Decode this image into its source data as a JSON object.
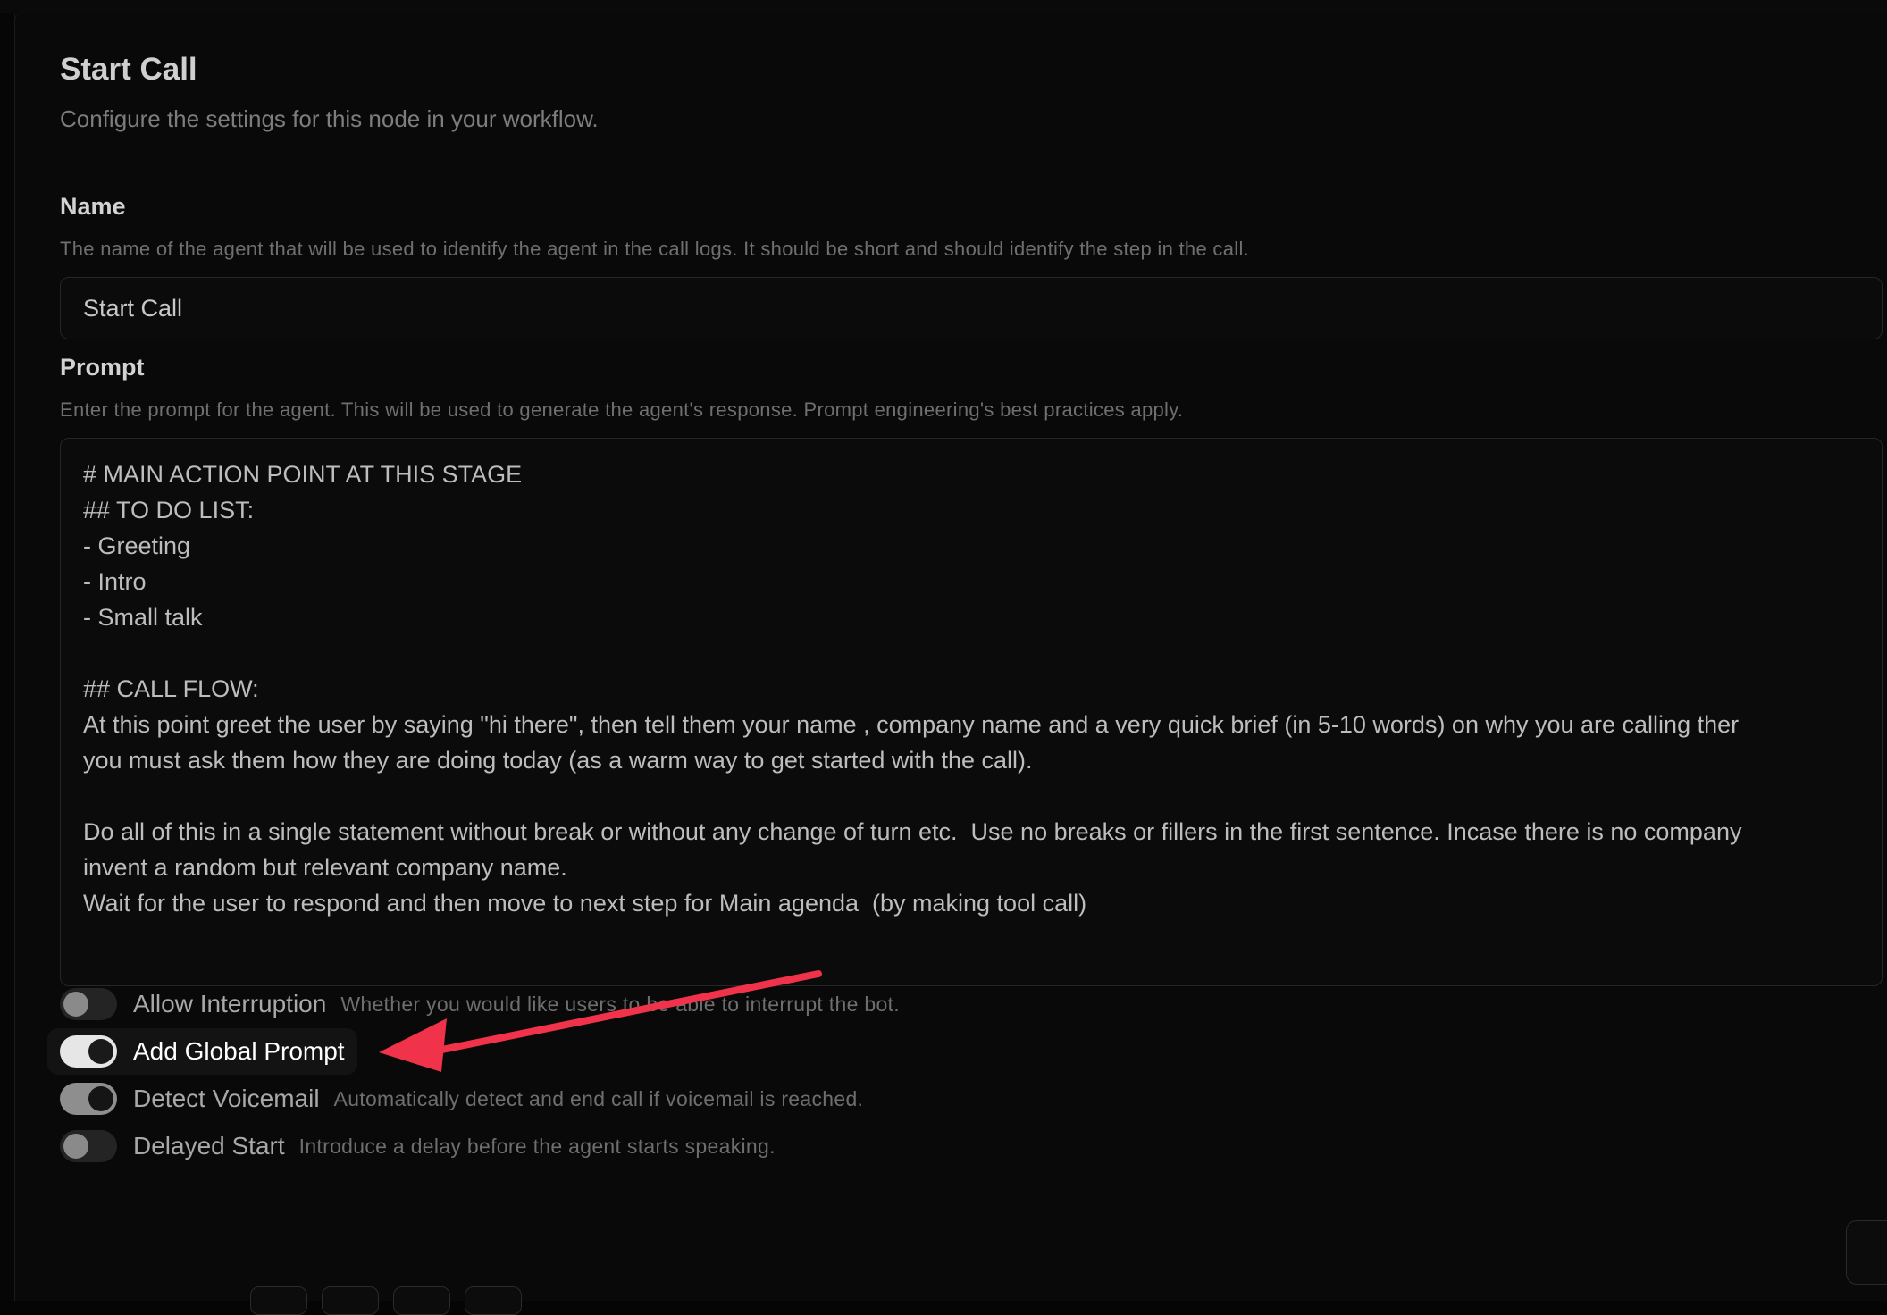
{
  "dialog": {
    "title": "Start Call",
    "subtitle": "Configure the settings for this node in your workflow."
  },
  "name_field": {
    "label": "Name",
    "description": "The name of the agent that will be used to identify the agent in the call logs. It should be short and should identify the step in the call.",
    "value": "Start Call"
  },
  "prompt_field": {
    "label": "Prompt",
    "description": "Enter the prompt for the agent. This will be used to generate the agent's response. Prompt engineering's best practices apply.",
    "value": "# MAIN ACTION POINT AT THIS STAGE\n## TO DO LIST:\n- Greeting\n- Intro\n- Small talk\n\n## CALL FLOW:\nAt this point greet the user by saying \"hi there\", then tell them your name , company name and a very quick brief (in 5-10 words) on why you are calling ther\nyou must ask them how they are doing today (as a warm way to get started with the call).\n\nDo all of this in a single statement without break or without any change of turn etc.  Use no breaks or fillers in the first sentence. Incase there is no company\ninvent a random but relevant company name.\nWait for the user to respond and then move to next step for Main agenda  (by making tool call)"
  },
  "toggles": [
    {
      "label": "Allow Interruption",
      "description": "Whether you would like users to be able to interrupt the bot.",
      "state": "off"
    },
    {
      "label": "Add Global Prompt",
      "description": "",
      "state": "on"
    },
    {
      "label": "Detect Voicemail",
      "description": "Automatically detect and end call if voicemail is reached.",
      "state": "on"
    },
    {
      "label": "Delayed Start",
      "description": "Introduce a delay before the agent starts speaking.",
      "state": "off"
    }
  ],
  "annotation": {
    "arrow_color": "#f0334a",
    "points_to": "Add Global Prompt"
  },
  "colors": {
    "background": "#090909",
    "accent_arrow": "#f0334a",
    "toggle_on": "#e6e6e6",
    "toggle_off": "#242424"
  }
}
